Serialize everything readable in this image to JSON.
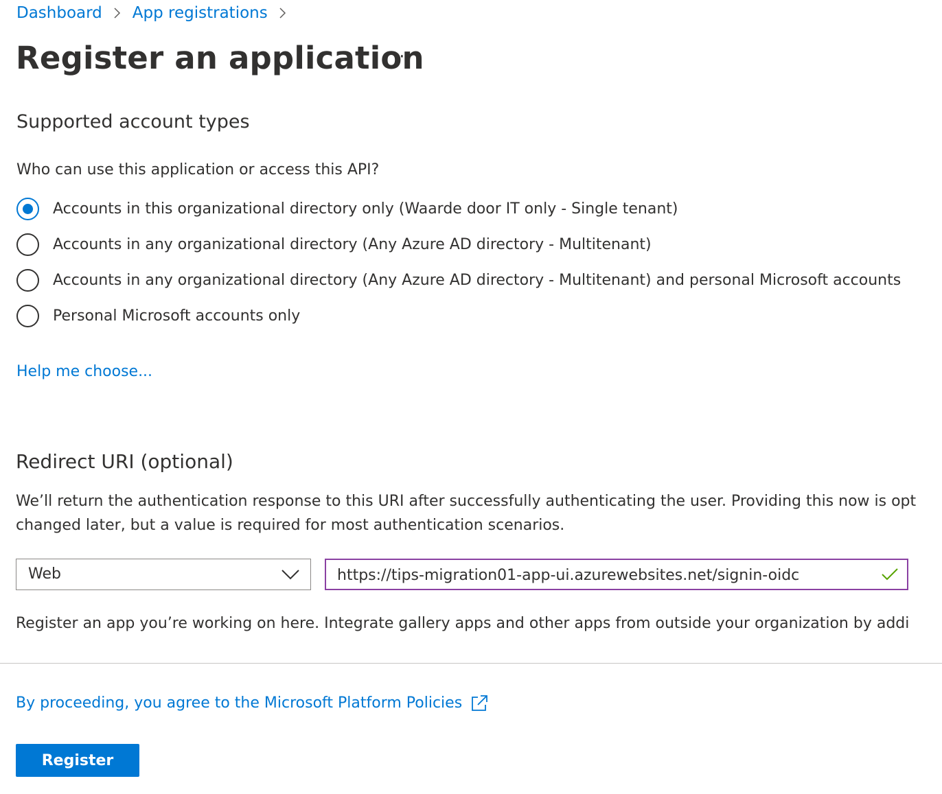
{
  "breadcrumb": {
    "items": [
      "Dashboard",
      "App registrations"
    ]
  },
  "page": {
    "title": "Register an application",
    "more_label": "···"
  },
  "account_types": {
    "heading": "Supported account types",
    "question": "Who can use this application or access this API?",
    "options": [
      {
        "label": "Accounts in this organizational directory only (Waarde door IT only - Single tenant)",
        "checked": true
      },
      {
        "label": "Accounts in any organizational directory (Any Azure AD directory - Multitenant)",
        "checked": false
      },
      {
        "label": "Accounts in any organizational directory (Any Azure AD directory - Multitenant) and personal Microsoft accounts",
        "checked": false
      },
      {
        "label": "Personal Microsoft accounts only",
        "checked": false
      }
    ],
    "help_link": "Help me choose..."
  },
  "redirect": {
    "heading": "Redirect URI (optional)",
    "description_line1": "We’ll return the authentication response to this URI after successfully authenticating the user. Providing this now is opt",
    "description_line2": "changed later, but a value is required for most authentication scenarios.",
    "platform_selected": "Web",
    "uri_value": "https://tips-migration01-app-ui.azurewebsites.net/signin-oidc",
    "validation_icon": "check-icon",
    "validation_color": "#57a300"
  },
  "footer": {
    "info_text": "Register an app you’re working on here. Integrate gallery apps and other apps from outside your organization by addi",
    "policy_link": "By proceeding, you agree to the Microsoft Platform Policies",
    "register_label": "Register"
  },
  "colors": {
    "accent": "#0078d4",
    "input_focus_border": "#8a40a2"
  }
}
